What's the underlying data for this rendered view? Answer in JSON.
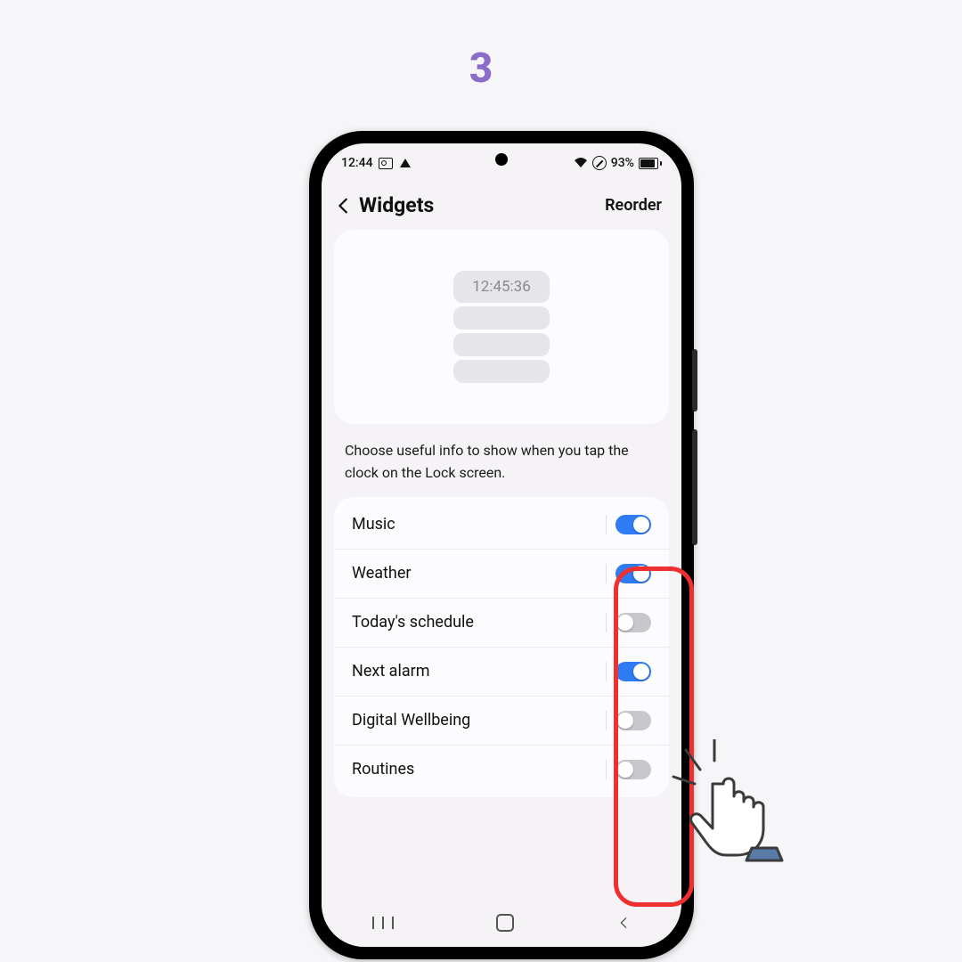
{
  "step_number": "3",
  "statusbar": {
    "time": "12:44",
    "battery_text": "93%"
  },
  "header": {
    "title": "Widgets",
    "action": "Reorder"
  },
  "preview": {
    "clock_text": "12:45:36"
  },
  "helper_text": "Choose useful info to show when you tap the clock on the Lock screen.",
  "widgets": [
    {
      "label": "Music",
      "enabled": true
    },
    {
      "label": "Weather",
      "enabled": true
    },
    {
      "label": "Today's schedule",
      "enabled": false
    },
    {
      "label": "Next alarm",
      "enabled": true
    },
    {
      "label": "Digital Wellbeing",
      "enabled": false
    },
    {
      "label": "Routines",
      "enabled": false
    }
  ],
  "colors": {
    "accent": "#2f7af5",
    "highlight": "#ef3030",
    "step": "#8b6dc9"
  }
}
